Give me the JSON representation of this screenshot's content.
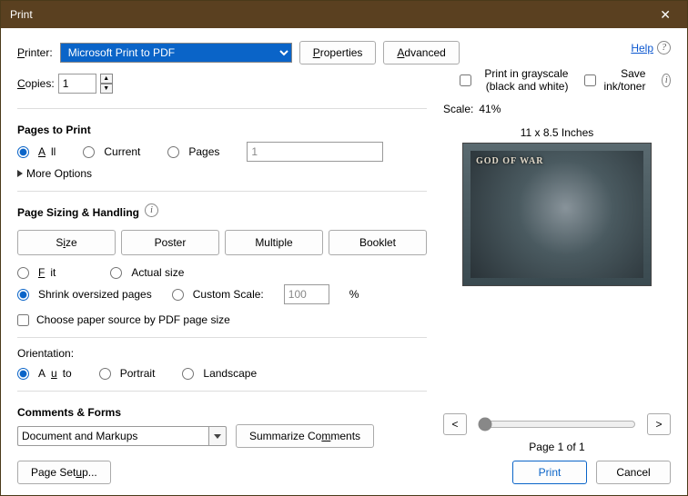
{
  "titlebar": {
    "title": "Print"
  },
  "header": {
    "printer_label": "Printer:",
    "printer_value": "Microsoft Print to PDF",
    "properties_btn": "Properties",
    "advanced_btn": "Advanced",
    "help_link": "Help",
    "copies_label": "Copies:",
    "copies_value": "1",
    "grayscale_label": "Print in grayscale (black and white)",
    "saveink_label": "Save ink/toner"
  },
  "pages_to_print": {
    "title": "Pages to Print",
    "all": "All",
    "current": "Current",
    "pages": "Pages",
    "range_value": "1",
    "more_options": "More Options"
  },
  "sizing": {
    "title": "Page Sizing & Handling",
    "size": "Size",
    "poster": "Poster",
    "multiple": "Multiple",
    "booklet": "Booklet",
    "fit": "Fit",
    "actual": "Actual size",
    "shrink": "Shrink oversized pages",
    "custom": "Custom Scale:",
    "custom_value": "100",
    "percent": "%",
    "choose_paper": "Choose paper source by PDF page size"
  },
  "orientation": {
    "title": "Orientation:",
    "auto": "Auto",
    "portrait": "Portrait",
    "landscape": "Landscape"
  },
  "comments": {
    "title": "Comments & Forms",
    "value": "Document and Markups",
    "summarize": "Summarize Comments"
  },
  "preview": {
    "scale_label": "Scale:",
    "scale_value": "41%",
    "dimensions": "11 x 8.5 Inches",
    "logo_text": "GOD OF WAR",
    "prev": "<",
    "next": ">",
    "page_of": "Page 1 of 1"
  },
  "footer": {
    "page_setup": "Page Setup...",
    "print": "Print",
    "cancel": "Cancel"
  }
}
